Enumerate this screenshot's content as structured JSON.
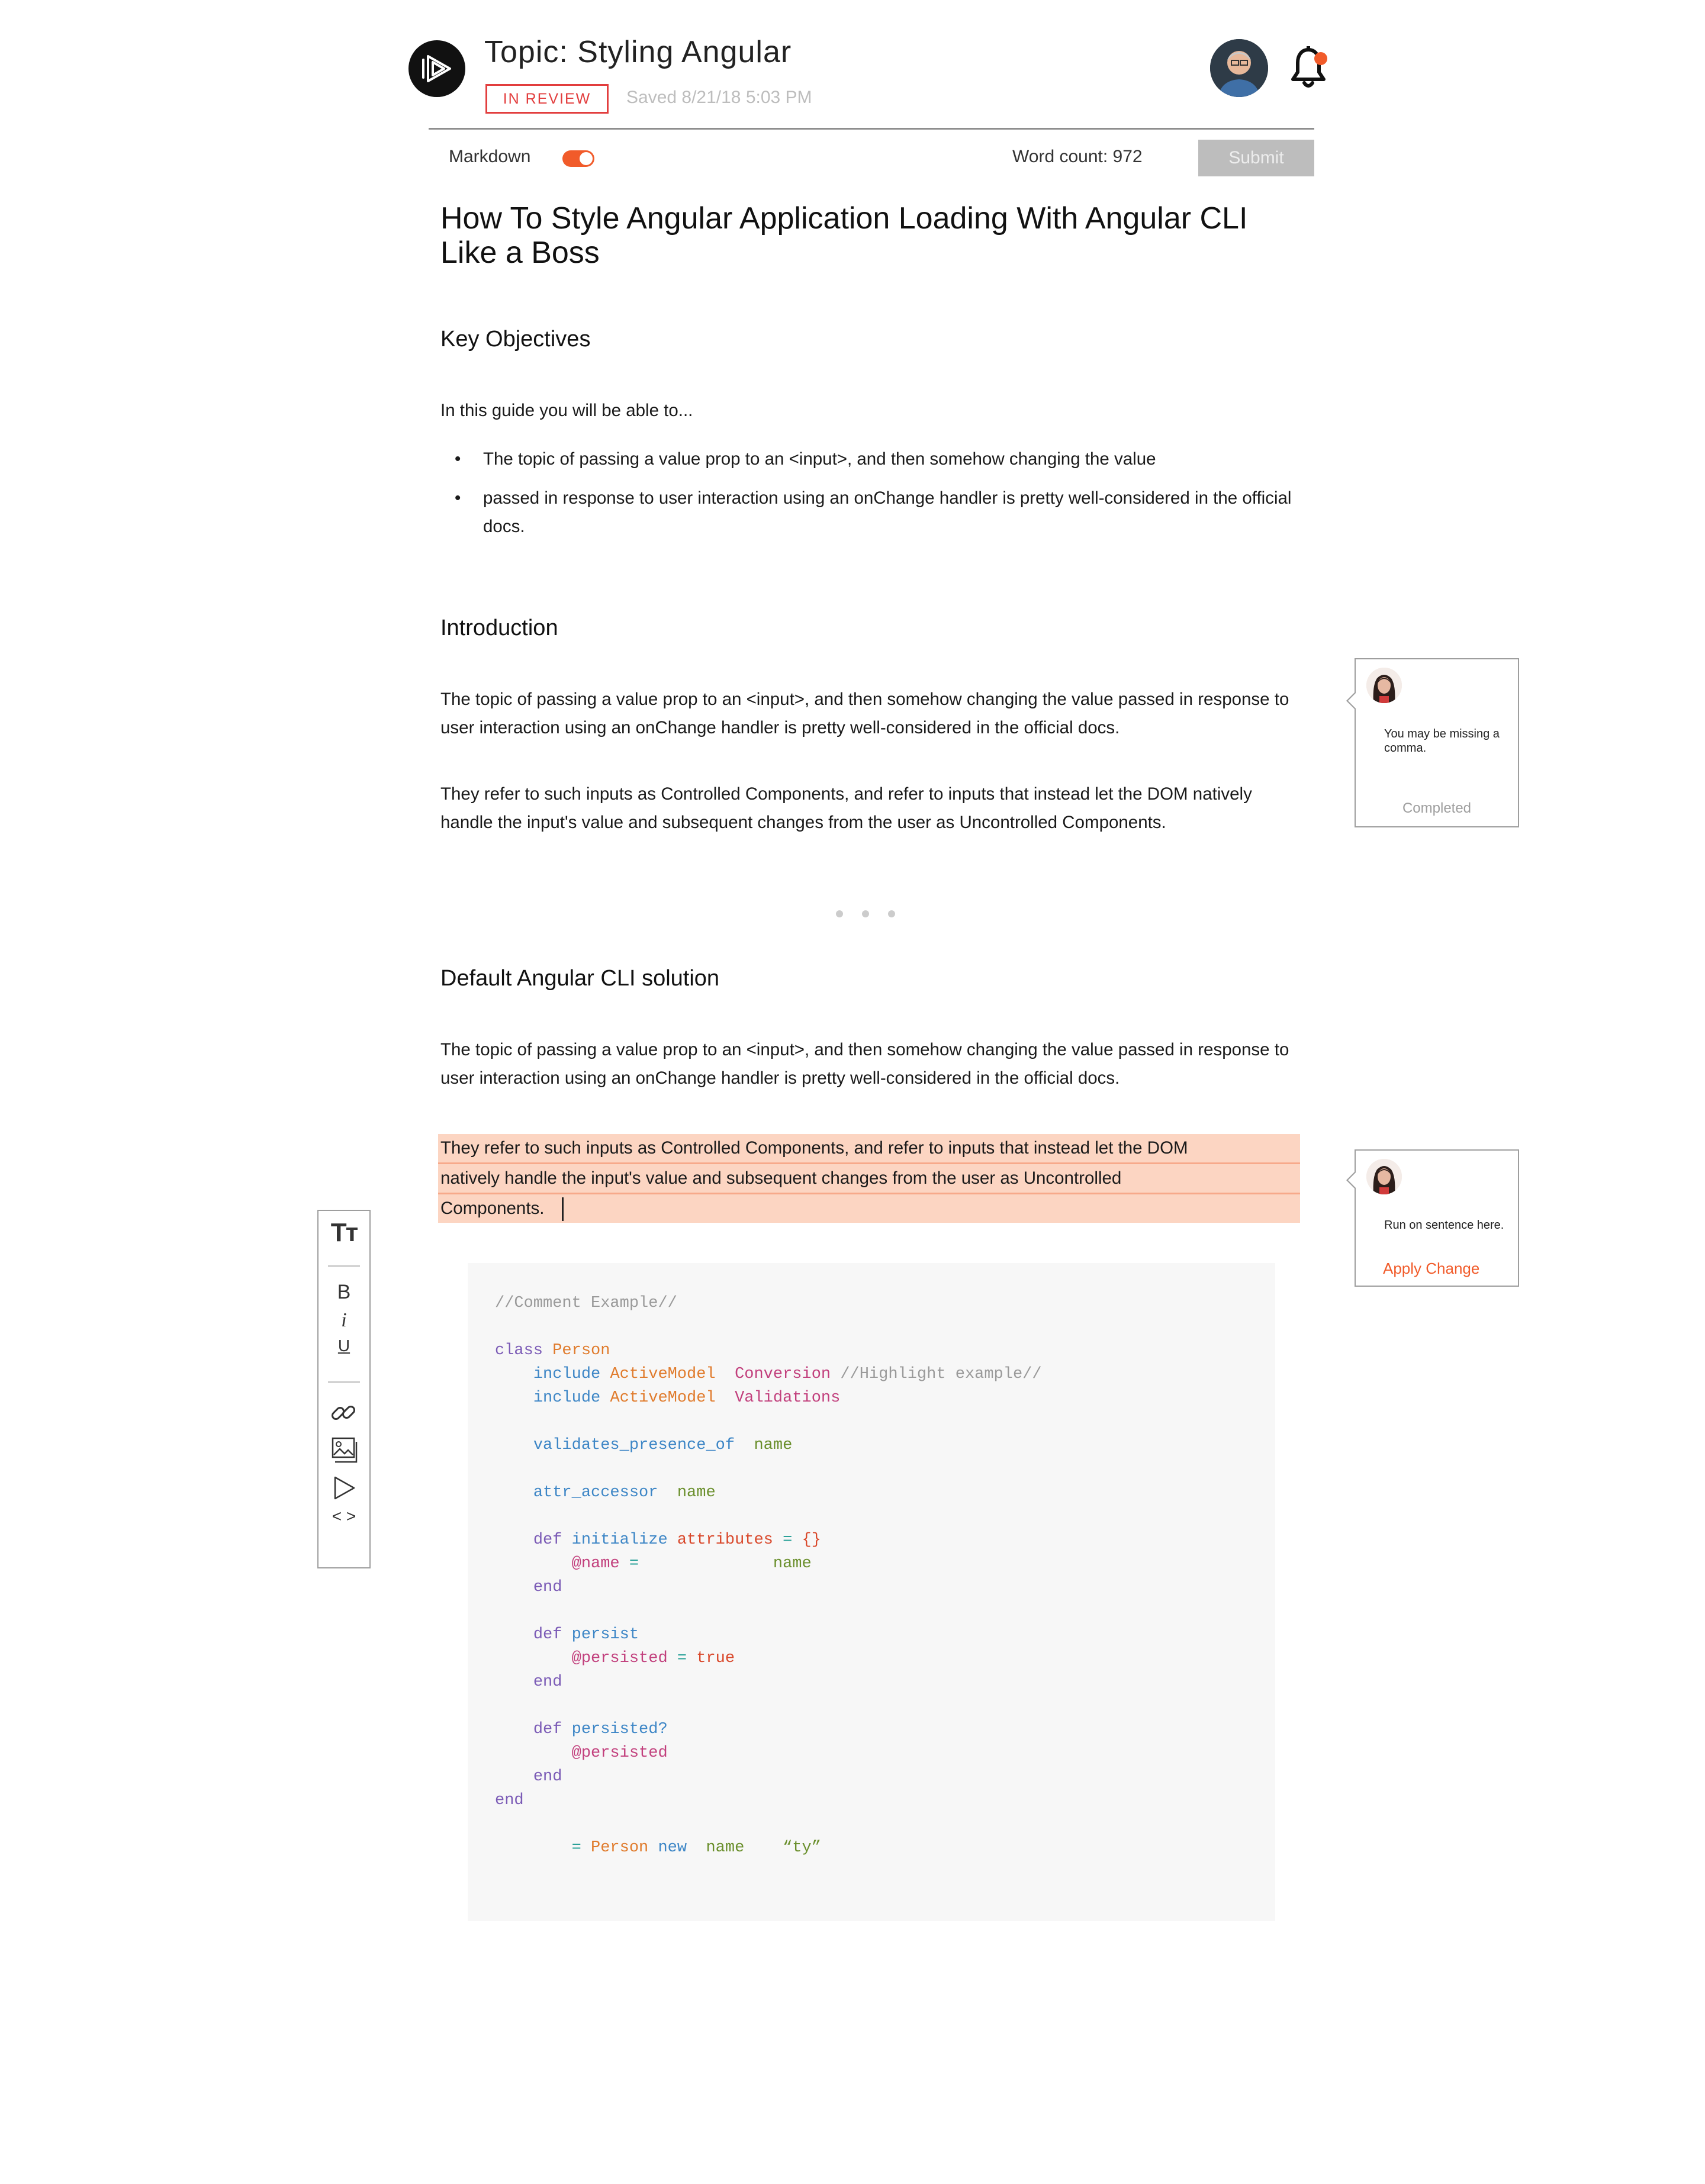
{
  "header": {
    "topic_title": "Topic: Styling Angular",
    "status_badge": "IN REVIEW",
    "saved_text": "Saved  8/21/18 5:03 PM"
  },
  "toolbar": {
    "markdown_label": "Markdown",
    "markdown_enabled": true,
    "word_count": "Word count: 972",
    "submit_label": "Submit"
  },
  "document": {
    "title": "How To Style Angular Application Loading With Angular CLI Like a Boss",
    "sections": {
      "key_objectives": {
        "heading": "Key Objectives",
        "intro": "In this guide you will be able to...",
        "bullets": [
          "The topic of passing a value prop to an <input>, and then somehow changing the value",
          "passed in response to user interaction using an onChange handler is pretty well-considered in the official docs."
        ]
      },
      "introduction": {
        "heading": "Introduction",
        "paragraphs": [
          "The topic of passing a value prop to an <input>, and then somehow changing the value passed in response to user interaction using an onChange handler is pretty well-considered in the official docs.",
          "They refer to such inputs as Controlled Components, and refer to inputs that instead let the DOM natively handle the input's value and subsequent changes from the user as Uncontrolled Components."
        ]
      },
      "default_cli": {
        "heading": "Default Angular CLI solution",
        "paragraph": "The topic of passing a value prop to an <input>, and then somehow changing the value passed in response to user interaction using an onChange handler is pretty well-considered in the official docs.",
        "highlighted_lines": [
          "They refer to such inputs as Controlled Components, and refer to inputs that instead let the DOM",
          "natively handle the input's value and subsequent changes from the user as Uncontrolled",
          "Components."
        ]
      }
    },
    "code": {
      "comment": "//Comment Example//",
      "class_kw": "class",
      "class_name": "Person",
      "include_kw": "include",
      "active_model": "ActiveModel",
      "conversion": "Conversion",
      "highlight_comment": "//Highlight example//",
      "validations": "Validations",
      "validates_presence_of": "validates_presence_of",
      "name_sym": "name",
      "attr_accessor": "attr_accessor",
      "def_kw": "def",
      "initialize": "initialize",
      "attributes": "attributes",
      "eq": "=",
      "empty_hash": "{}",
      "at_name": "@name",
      "end_kw": "end",
      "persist": "persist",
      "at_persisted": "@persisted",
      "true_kw": "true",
      "persisted_q": "persisted?",
      "new_kw": "new",
      "ty_str": "“ty”"
    }
  },
  "format_toolbar": {
    "text_size": "Tт",
    "bold": "B",
    "italic": "i",
    "underline": "U",
    "code": "< >",
    "icons": [
      "text-size-icon",
      "bold-icon",
      "italic-icon",
      "underline-icon",
      "link-icon",
      "image-icon",
      "video-icon",
      "code-icon"
    ]
  },
  "comments": [
    {
      "text": "You may be missing a comma.",
      "status": "Completed"
    },
    {
      "text": "Run on sentence here.",
      "action": "Apply Change"
    }
  ],
  "colors": {
    "accent": "#f15b2a",
    "review_red": "#e23e3e",
    "highlight": "#fcd5c2",
    "submit_disabled": "#bdbdbd"
  }
}
